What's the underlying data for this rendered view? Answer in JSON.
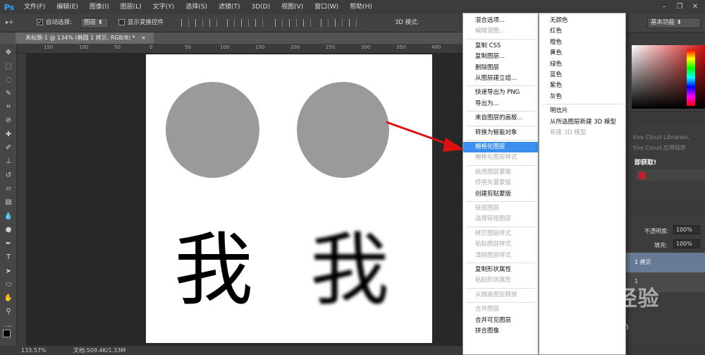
{
  "app": {
    "logo": "Ps"
  },
  "menubar": {
    "items": [
      "文件(F)",
      "编辑(E)",
      "图像(I)",
      "图层(L)",
      "文字(Y)",
      "选择(S)",
      "滤镜(T)",
      "3D(D)",
      "视图(V)",
      "窗口(W)",
      "帮助(H)"
    ],
    "window_controls": [
      "–",
      "❐",
      "✕"
    ]
  },
  "options": {
    "tool_glyph": "▸+",
    "auto_select_label": "自动选择:",
    "auto_select_value": "图层",
    "show_transform_label": "显示变换控件",
    "mode_3d_label": "3D 模式:",
    "workspace_value": "基本功能"
  },
  "document": {
    "tab_title": "未标题-1 @ 134% (椭圆 1 拷贝, RGB/8) *",
    "tab_close": "×",
    "glyph_left": "我",
    "glyph_right": "我"
  },
  "ruler": {
    "labels": [
      "150",
      "100",
      "50",
      "0",
      "50",
      "100",
      "150",
      "200",
      "250",
      "300",
      "350",
      "400"
    ]
  },
  "status": {
    "zoom": "133.57%",
    "doc": "文档:509.4K/1.33M"
  },
  "context_menu": [
    {
      "label": "混合选项...",
      "enabled": true
    },
    {
      "label": "编辑调整...",
      "enabled": false
    },
    {
      "sep": true
    },
    {
      "label": "复制 CSS",
      "enabled": true
    },
    {
      "label": "复制图层...",
      "enabled": true
    },
    {
      "label": "删除图层",
      "enabled": true
    },
    {
      "label": "从图层建立组...",
      "enabled": true
    },
    {
      "sep": true
    },
    {
      "label": "快速导出为 PNG",
      "enabled": true
    },
    {
      "label": "导出为...",
      "enabled": true
    },
    {
      "sep": true
    },
    {
      "label": "来自图层的画板...",
      "enabled": true
    },
    {
      "sep": true
    },
    {
      "label": "转换为智能对象",
      "enabled": true
    },
    {
      "sep": true
    },
    {
      "label": "栅格化图层",
      "enabled": true,
      "highlight": true
    },
    {
      "label": "栅格化图层样式",
      "enabled": false
    },
    {
      "sep": true
    },
    {
      "label": "启用图层蒙版",
      "enabled": false
    },
    {
      "label": "停用矢量蒙版",
      "enabled": false
    },
    {
      "label": "创建剪贴蒙版",
      "enabled": true
    },
    {
      "sep": true
    },
    {
      "label": "链接图层",
      "enabled": false
    },
    {
      "label": "选择链接图层",
      "enabled": false
    },
    {
      "sep": true
    },
    {
      "label": "拷贝图层样式",
      "enabled": false
    },
    {
      "label": "粘贴图层样式",
      "enabled": false
    },
    {
      "label": "清除图层样式",
      "enabled": false
    },
    {
      "sep": true
    },
    {
      "label": "复制形状属性",
      "enabled": true
    },
    {
      "label": "粘贴形状属性",
      "enabled": false
    },
    {
      "sep": true
    },
    {
      "label": "从隔离图层释放",
      "enabled": false
    },
    {
      "sep": true
    },
    {
      "label": "合并图层",
      "enabled": false
    },
    {
      "label": "合并可见图层",
      "enabled": true
    },
    {
      "label": "拼合图像",
      "enabled": true
    }
  ],
  "sub_menu": [
    {
      "label": "无颜色",
      "enabled": true
    },
    {
      "label": "红色",
      "enabled": true
    },
    {
      "label": "橙色",
      "enabled": true
    },
    {
      "label": "黄色",
      "enabled": true
    },
    {
      "label": "绿色",
      "enabled": true
    },
    {
      "label": "蓝色",
      "enabled": true
    },
    {
      "label": "紫色",
      "enabled": true
    },
    {
      "label": "灰色",
      "enabled": true
    },
    {
      "sep": true
    },
    {
      "label": "明信片",
      "enabled": true
    },
    {
      "label": "从所选图层新建 3D 模型",
      "enabled": true
    },
    {
      "label": "新建 3D 模型",
      "enabled": false
    }
  ],
  "right_panel": {
    "cc_line1": "tive Cloud Libraries,",
    "cc_line2": "tive Cloud 应用程序",
    "cc_line3": "即获取!",
    "opacity_label": "不透明度:",
    "opacity_value": "100%",
    "fill_label": "填充:",
    "fill_value": "100%",
    "layer1": "1 拷贝",
    "layer2": "1"
  },
  "watermark": {
    "brand": "Bai",
    "brand2": "经验",
    "url": "jingyan.baidu.com"
  },
  "colors": {
    "accent": "#3c90f0",
    "arrow": "#e01010",
    "circle": "#9a9a9a"
  }
}
